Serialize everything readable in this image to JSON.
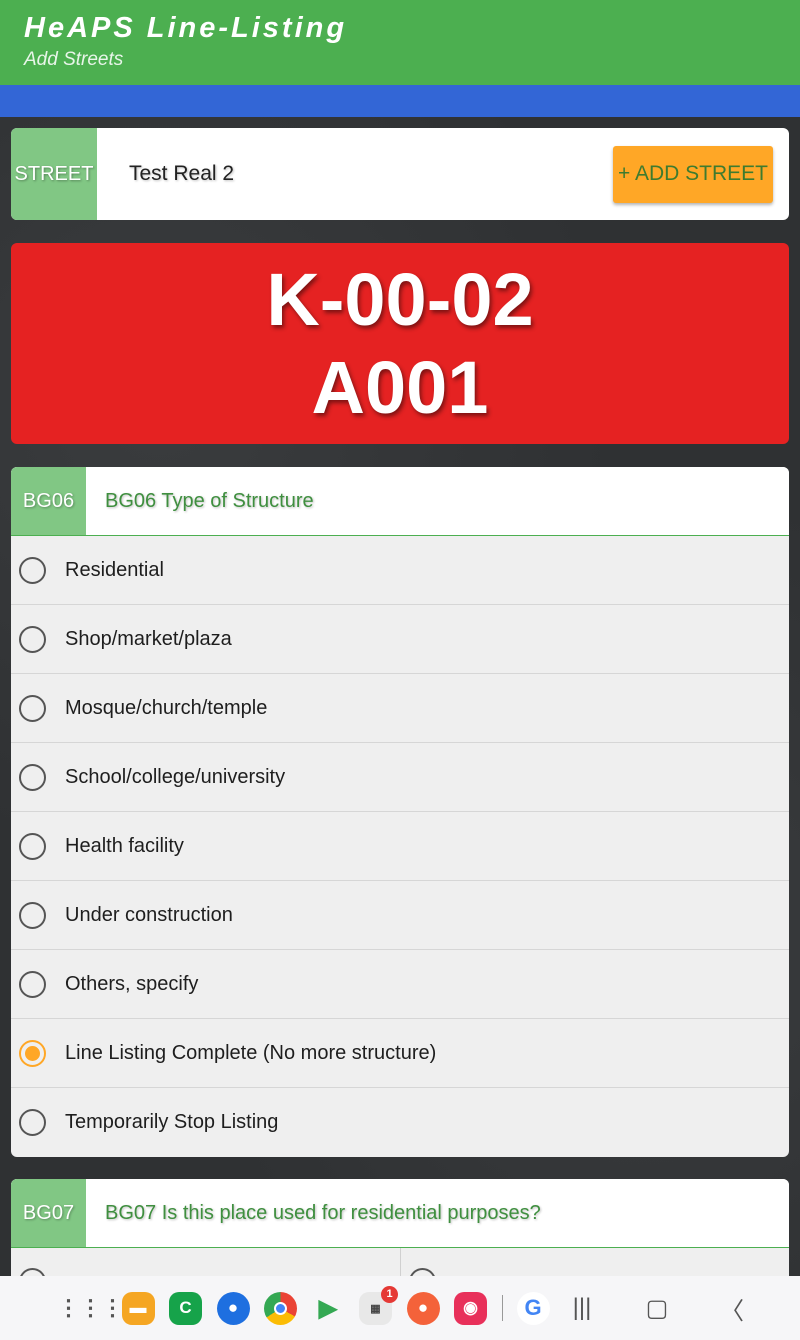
{
  "app": {
    "title": "HeAPS Line-Listing",
    "subtitle": "Add Streets"
  },
  "street": {
    "tag": "STREET",
    "value": "Test Real 2",
    "add_button": "+ ADD STREET"
  },
  "identifier": {
    "line1": "K-00-02",
    "line2": "A001"
  },
  "question_bg06": {
    "tag": "BG06",
    "text": "BG06 Type of Structure",
    "selected_index": 7,
    "options": [
      "Residential",
      "Shop/market/plaza",
      "Mosque/church/temple",
      "School/college/university",
      "Health facility",
      "Under construction",
      "Others, specify",
      "Line Listing Complete (No more structure)",
      "Temporarily Stop Listing"
    ]
  },
  "question_bg07": {
    "tag": "BG07",
    "text": "BG07 Is this place used for residential purposes?"
  },
  "navbar": {
    "apps": [
      "apps-grid-icon",
      "my-files-icon",
      "phone-icon",
      "messages-icon",
      "chrome-icon",
      "play-store-icon",
      "app-with-badge-icon",
      "contacts-icon",
      "camera-icon",
      "google-icon"
    ],
    "badge_count": "1",
    "recent_glyph": "|||",
    "home_glyph": "▢",
    "back_glyph": "〈"
  },
  "colors": {
    "appbar": "#4caf50",
    "strip": "#3366d6",
    "id_card": "#e52222",
    "accent": "#ffa726"
  }
}
